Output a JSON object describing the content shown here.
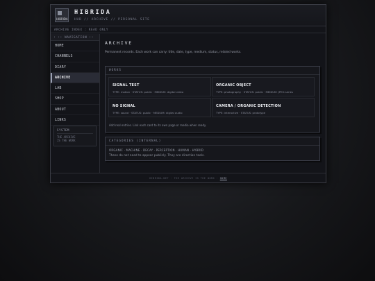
{
  "header": {
    "logo_text": "HIBRIDA",
    "title": "HIBRIDA",
    "subtitle": "HUB // ARCHIVE // PERSONAL SITE"
  },
  "crumbbar": {
    "text": "ARCHIVE INDEX : READ ONLY"
  },
  "sidebar": {
    "heading": ": :: NAVIGATION ::",
    "items": [
      {
        "label": "HOME"
      },
      {
        "label": "CHANNELS"
      },
      {
        "label": "DIARY"
      },
      {
        "label": "ARCHIVE"
      },
      {
        "label": "LAB"
      },
      {
        "label": "SHOP"
      },
      {
        "label": "ABOUT"
      },
      {
        "label": "LINKS"
      }
    ],
    "active_index": 3,
    "system": {
      "title": "SYSTEM",
      "line1": "THE ARCHIVE",
      "line2": "IS THE WORK"
    }
  },
  "main": {
    "title": "ARCHIVE",
    "intro": "Permanent records. Each work can carry: title, date, type, medium, status, related works.",
    "works_panel": {
      "heading": "WORKS",
      "cards": [
        {
          "name": "SIGNAL TEST",
          "meta": "TYPE: motion · STATUS: public · MEDIUM: digital video"
        },
        {
          "name": "ORGANIC OBJECT",
          "meta": "TYPE: photography · STATUS: public · MEDIUM: JPEG series"
        },
        {
          "name": "NO SIGNAL",
          "meta": "TYPE: sound · STATUS: public · MEDIUM: digital audio"
        },
        {
          "name": "CAMERA / ORGANIC DETECTION",
          "meta": "TYPE: interactive · STATUS: prototype"
        }
      ],
      "note": "Add real entries. Link each card to its own page or media when ready."
    },
    "categories_panel": {
      "heading": "CATEGORIES (INTERNAL)",
      "line1": "ORGANIC · MACHINE · DECAY · PERCEPTION · HUMAN · HYBRID",
      "line2": "These do not need to appear publicly. They are direction tools."
    }
  },
  "footer": {
    "text": "HIBRIDA.NET · THE ARCHIVE IS THE WORK ·",
    "link": "HOME"
  }
}
